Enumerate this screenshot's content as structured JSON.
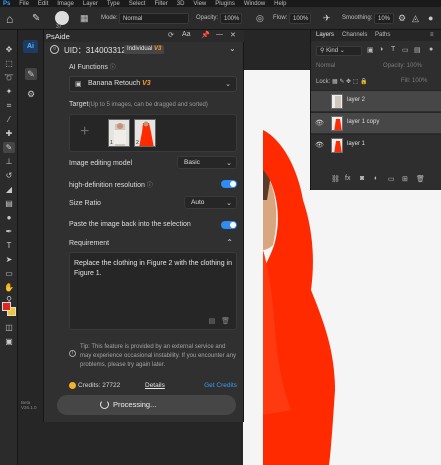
{
  "menu_bar": [
    "File",
    "Edit",
    "Image",
    "Layer",
    "Type",
    "Select",
    "Filter",
    "3D",
    "View",
    "Plugins",
    "Window",
    "Help"
  ],
  "options_bar": {
    "brush_size": "37",
    "mode_label": "Mode:",
    "mode_value": "Normal",
    "opacity_label": "Opacity:",
    "opacity_value": "100%",
    "flow_label": "Flow:",
    "flow_value": "100%",
    "smoothing_label": "Smoothing:",
    "smoothing_value": "10%"
  },
  "colors": {
    "foreground": "#e3261b",
    "background": "#f2c62b",
    "accent": "#2f8cf0",
    "version_tag": "#ff9a2e",
    "canvas_figure": "#ff2a00"
  },
  "psaide": {
    "title": "PsAide",
    "rail_icon": "Ai",
    "version": "Beta V26.1.0",
    "uid": "UID：314003312",
    "plan": "Individual",
    "plan_version": "V3",
    "ai_functions_label": "AI Functions",
    "ai_function_name": "Banana Retouch",
    "ai_function_version": "V3",
    "target_label": "Target",
    "target_hint": "(Up to 5 images, can be dragged and sorted)",
    "thumbs": [
      {
        "num": "1"
      },
      {
        "num": "2"
      }
    ],
    "editing_model_label": "Image editing model",
    "editing_model_value": "Basic",
    "hd_label": "high-definition resolution",
    "ratio_label": "Size Ratio",
    "ratio_value": "Auto",
    "paste_label": "Paste the image back into the selection",
    "requirement_label": "Requirement",
    "requirement_text": "Replace the clothing in Figure 2 with the clothing in Figure 1.",
    "tip": "Tip: This feature is provided by an external service and may experience occasional instability. If you encounter any problems, please try again later.",
    "credits": "Credits: 27722",
    "details": "Details",
    "get_credits": "Get Credits",
    "processing": "Processing..."
  },
  "layers_panel": {
    "tabs": [
      "Layers",
      "Channels",
      "Paths"
    ],
    "kind": "Kind",
    "blend": "Normal",
    "opacity": "Opacity: 100%",
    "lock": "Lock:",
    "fill": "Fill: 100%",
    "layers": [
      {
        "name": "layer 2",
        "visible": false,
        "selected": true
      },
      {
        "name": "layer 1 copy",
        "visible": true,
        "selected": true
      },
      {
        "name": "layer 1",
        "visible": true,
        "selected": false
      }
    ]
  }
}
